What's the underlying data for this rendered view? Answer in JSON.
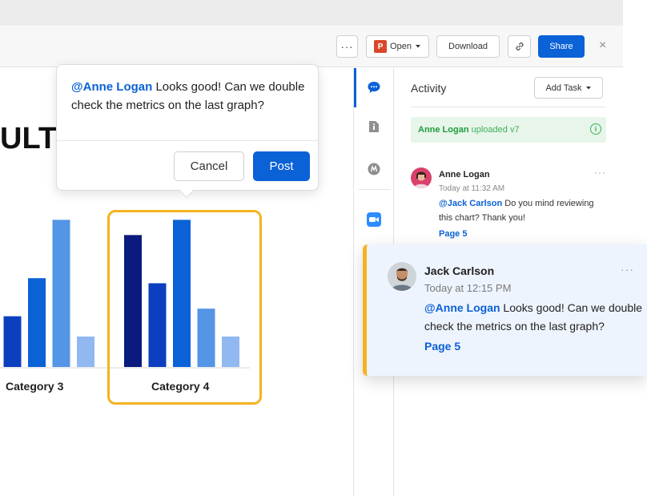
{
  "toolbar": {
    "more_label": "···",
    "open_label": "Open",
    "open_icon_letter": "P",
    "download_label": "Download",
    "share_label": "Share",
    "close_label": "×"
  },
  "document": {
    "title_fragment": "ULT",
    "chart_data": {
      "type": "bar",
      "categories": [
        "Category 3",
        "Category 4"
      ],
      "series": [
        {
          "values": [
            null,
            52
          ]
        },
        {
          "values": [
            20,
            33
          ]
        },
        {
          "values": [
            35,
            58
          ]
        },
        {
          "values": [
            58,
            23
          ]
        },
        {
          "values": [
            12,
            12
          ]
        }
      ],
      "colors": [
        "#0a1a7e",
        "#0b3fbf",
        "#0b61d6",
        "#5495e6",
        "#91b8f0"
      ],
      "ylim": [
        0,
        60
      ],
      "highlighted_category": "Category 4"
    }
  },
  "comment_popover": {
    "mention": "@Anne Logan",
    "text": " Looks good! Can we double check the metrics on the last graph?",
    "cancel_label": "Cancel",
    "post_label": "Post"
  },
  "sidebar": {
    "rail_icons": [
      "comment-icon",
      "document-icon",
      "app-icon",
      "zoom-icon"
    ],
    "colors": {
      "accent": "#0b61d6",
      "highlight": "#f5b320"
    }
  },
  "activity": {
    "title": "Activity",
    "add_task_label": "Add Task",
    "upload_note": {
      "who": "Anne Logan",
      "what": " uploaded v7",
      "info": "i"
    },
    "comments": [
      {
        "author": "Anne Logan",
        "time": "Today at 11:32 AM",
        "mention": "@Jack Carlson",
        "text": " Do you mind reviewing this chart? Thank you!",
        "page": "Page 5",
        "more": "···"
      }
    ]
  },
  "reply_card": {
    "author": "Jack Carlson",
    "time": "Today at 12:15 PM",
    "mention": "@Anne Logan",
    "text": " Looks good! Can we double check the metrics on the last graph?",
    "page": "Page 5",
    "more": "···"
  }
}
